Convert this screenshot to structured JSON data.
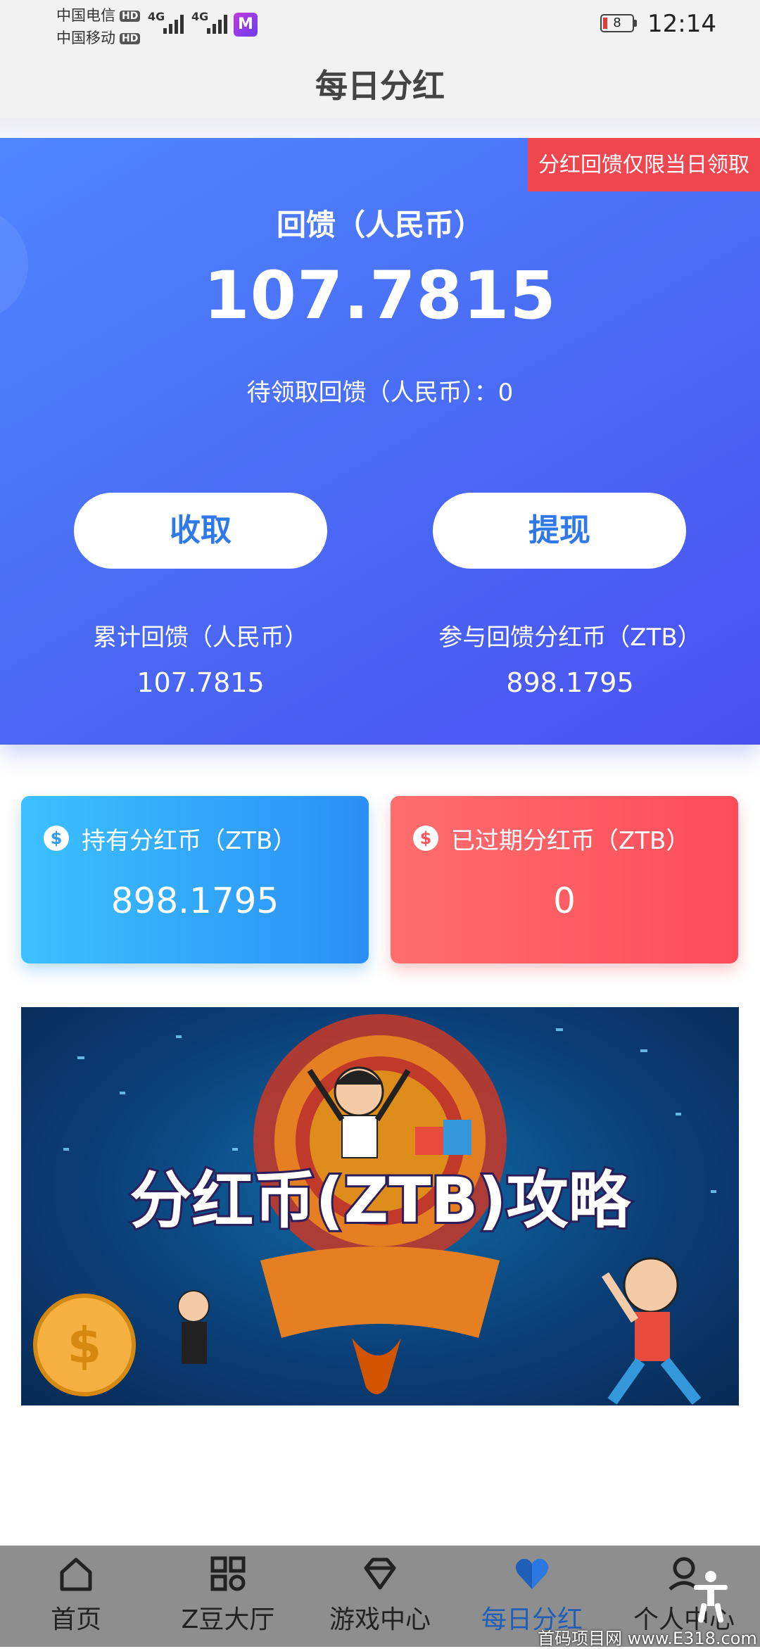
{
  "status_bar": {
    "carrier1": "中国电信",
    "carrier2": "中国移动",
    "hd": "HD",
    "net1": "4G",
    "net2": "4G",
    "app_badge": "M",
    "battery": "8",
    "time": "12:14"
  },
  "header": {
    "title": "每日分红"
  },
  "hero": {
    "notice": "分红回馈仅限当日领取",
    "label": "回馈（人民币）",
    "amount": "107.7815",
    "pending_label": "待领取回馈（人民币）：0",
    "collect_button": "收取",
    "withdraw_button": "提现",
    "total_label": "累计回馈（人民币）",
    "total_value": "107.7815",
    "participating_label": "参与回馈分红币（ZTB）",
    "participating_value": "898.1795"
  },
  "cards": {
    "held": {
      "icon": "dollar-circle-icon",
      "title": "持有分红币（ZTB）",
      "value": "898.1795"
    },
    "expired": {
      "icon": "dollar-circle-icon",
      "title": "已过期分红币（ZTB）",
      "value": "0"
    }
  },
  "banner": {
    "title": "分红币(ZTB)攻略"
  },
  "tabbar": {
    "tabs": [
      {
        "label": "首页",
        "icon": "home-icon"
      },
      {
        "label": "Z豆大厅",
        "icon": "grid-icon"
      },
      {
        "label": "游戏中心",
        "icon": "diamond-icon"
      },
      {
        "label": "每日分红",
        "icon": "heart-icon",
        "active": true
      },
      {
        "label": "个人中心",
        "icon": "user-icon"
      }
    ]
  },
  "watermark": "首码项目网 www.E318.com",
  "colors": {
    "hero_blue": "#4a6cf6",
    "notice_red": "#f0464f",
    "button_text": "#2f78ea",
    "card_blue": "#2a8ff6",
    "card_red": "#fe4c5a"
  }
}
